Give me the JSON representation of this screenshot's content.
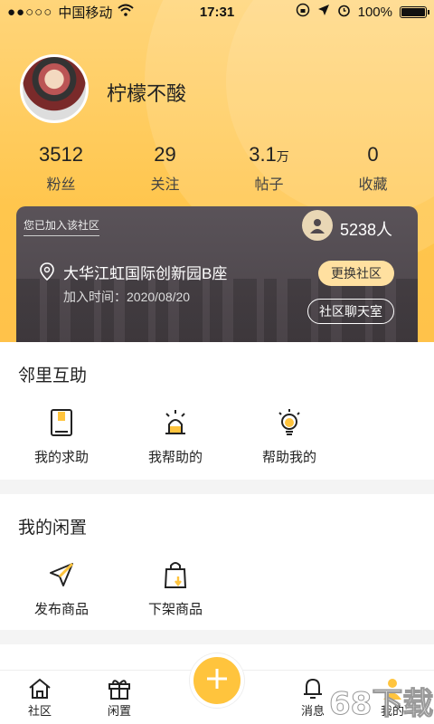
{
  "status_bar": {
    "dots": "●●○○○",
    "carrier": "中国移动",
    "time": "17:31",
    "battery": "100%"
  },
  "profile": {
    "username": "柠檬不酸"
  },
  "stats": [
    {
      "value": "3512",
      "unit": "",
      "label": "粉丝"
    },
    {
      "value": "29",
      "unit": "",
      "label": "关注"
    },
    {
      "value": "3.1",
      "unit": "万",
      "label": "帖子"
    },
    {
      "value": "0",
      "unit": "",
      "label": "收藏"
    }
  ],
  "community": {
    "joined_label": "您已加入该社区",
    "member_count": "5238人",
    "address": "大华江虹国际创新园B座",
    "join_time": "加入时间：2020/08/20",
    "change_button": "更换社区",
    "chat_button": "社区聊天室"
  },
  "help": {
    "title": "邻里互助",
    "items": [
      {
        "label": "我的求助",
        "icon": "book-icon"
      },
      {
        "label": "我帮助的",
        "icon": "alarm-light-icon"
      },
      {
        "label": "帮助我的",
        "icon": "lightbulb-icon"
      }
    ]
  },
  "idle": {
    "title": "我的闲置",
    "items": [
      {
        "label": "发布商品",
        "icon": "send-icon"
      },
      {
        "label": "下架商品",
        "icon": "bag-down-icon"
      }
    ]
  },
  "tabs": [
    {
      "label": "社区",
      "icon": "home-icon"
    },
    {
      "label": "闲置",
      "icon": "gift-box-icon"
    },
    {
      "label": "消息",
      "icon": "bell-icon"
    },
    {
      "label": "我的",
      "icon": "user-icon"
    }
  ],
  "watermark": "68下载",
  "colors": {
    "accent": "#ffc43d",
    "card": "#4f484d"
  }
}
